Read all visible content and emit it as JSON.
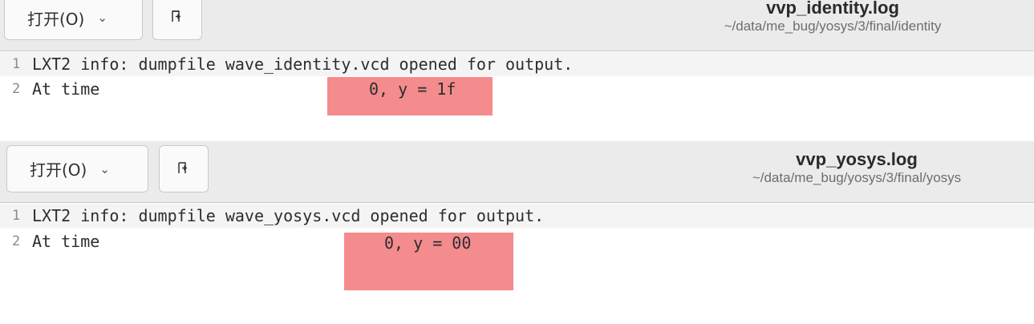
{
  "windows": [
    {
      "header": {
        "open_label": "打开(O)",
        "title": "vvp_identity.log",
        "subtitle": "~/data/me_bug/yosys/3/final/identity"
      },
      "lines": [
        {
          "num": "1",
          "text": "LXT2 info: dumpfile wave_identity.vcd opened for output."
        },
        {
          "num": "2",
          "text": "At time"
        }
      ],
      "highlight_text": "0, y = 1f",
      "highlight_color": "#f48b8d"
    },
    {
      "header": {
        "open_label": "打开(O)",
        "title": "vvp_yosys.log",
        "subtitle": "~/data/me_bug/yosys/3/final/yosys"
      },
      "lines": [
        {
          "num": "1",
          "text": "LXT2 info: dumpfile wave_yosys.vcd opened for output."
        },
        {
          "num": "2",
          "text": "At time"
        }
      ],
      "highlight_text": "0, y = 00",
      "highlight_color": "#f48b8d"
    }
  ],
  "icons": {
    "open_menu": "chevron-down-icon",
    "new_document": "new-document-icon"
  }
}
